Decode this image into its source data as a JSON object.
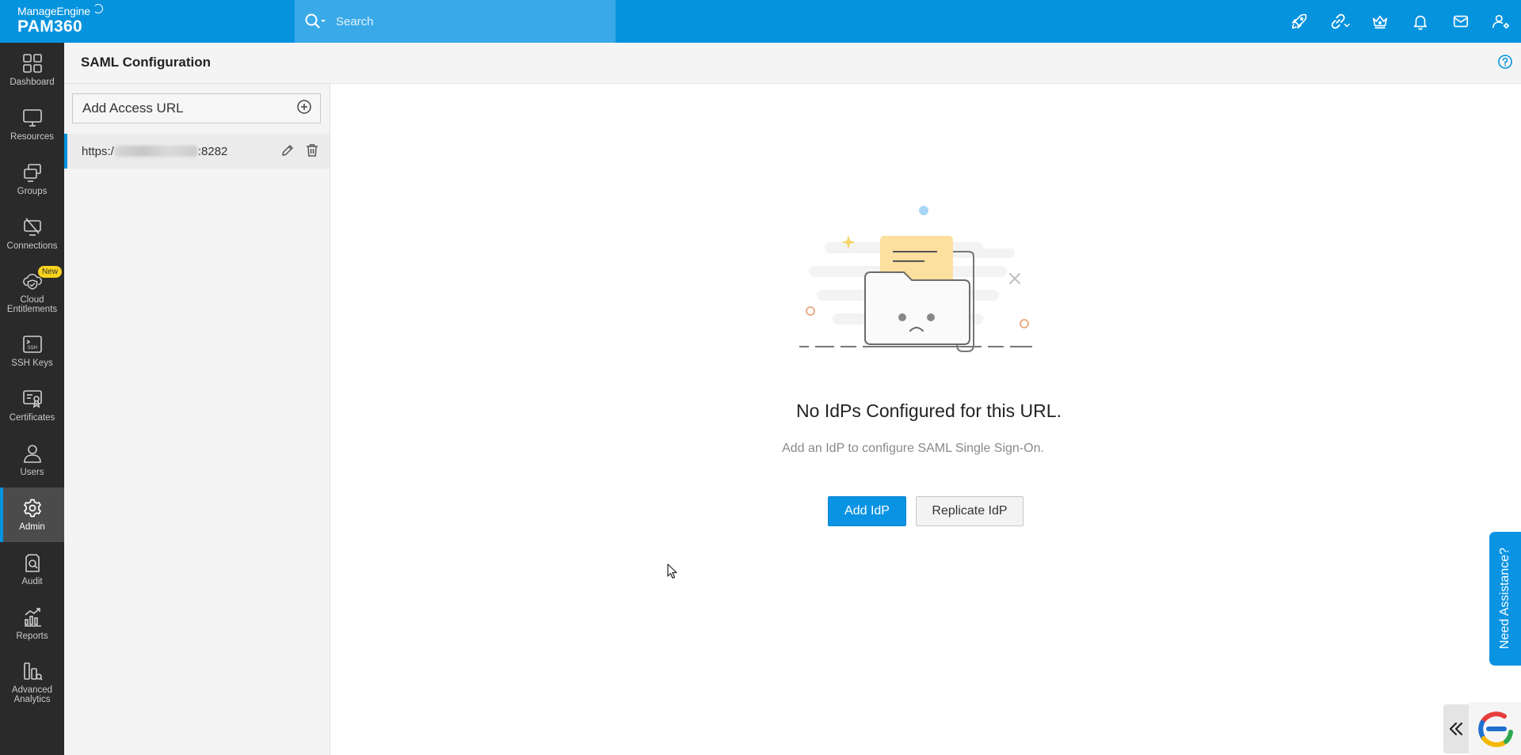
{
  "brand": {
    "company": "ManageEngine",
    "product": "PAM360"
  },
  "search": {
    "placeholder": "Search"
  },
  "top_icons": [
    "rocket-icon",
    "link-icon",
    "crown-icon",
    "bell-icon",
    "mail-icon",
    "user-settings-icon"
  ],
  "nav": {
    "items": [
      {
        "label": "Dashboard",
        "icon": "dashboard-icon"
      },
      {
        "label": "Resources",
        "icon": "monitor-icon"
      },
      {
        "label": "Groups",
        "icon": "groups-icon"
      },
      {
        "label": "Connections",
        "icon": "connections-icon"
      },
      {
        "label": "Cloud Entitlements",
        "icon": "cloud-shield-icon",
        "badge": "New"
      },
      {
        "label": "SSH Keys",
        "icon": "ssh-icon"
      },
      {
        "label": "Certificates",
        "icon": "certificate-icon"
      },
      {
        "label": "Users",
        "icon": "user-icon"
      },
      {
        "label": "Admin",
        "icon": "gear-icon"
      },
      {
        "label": "Audit",
        "icon": "audit-icon"
      },
      {
        "label": "Reports",
        "icon": "reports-icon"
      },
      {
        "label": "Advanced Analytics",
        "icon": "analytics-icon"
      }
    ],
    "active": "Admin"
  },
  "page": {
    "title": "SAML Configuration"
  },
  "url_panel": {
    "add_label": "Add Access URL",
    "urls": [
      {
        "prefix": "https:/",
        "suffix": ":8282"
      }
    ]
  },
  "empty_state": {
    "title": "No IdPs Configured for this URL.",
    "subtitle": "Add an IdP to configure SAML Single Sign-On.",
    "primary_button": "Add IdP",
    "secondary_button": "Replicate IdP"
  },
  "assistance": {
    "label": "Need Assistance?"
  },
  "colors": {
    "brand_blue": "#0593de",
    "nav_bg": "#2a2a2a",
    "badge": "#f8d21d"
  }
}
